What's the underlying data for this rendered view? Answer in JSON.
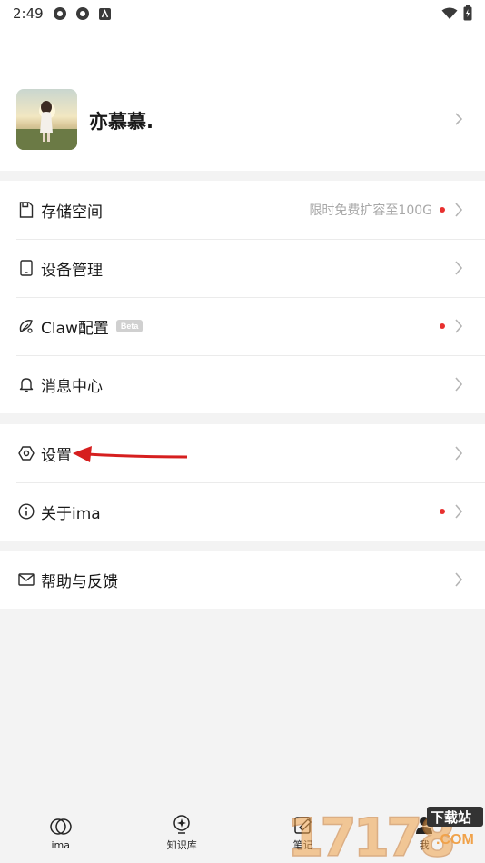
{
  "status_bar": {
    "time": "2:49"
  },
  "profile": {
    "username": "亦慕慕."
  },
  "menu_group_1": [
    {
      "label": "存储空间",
      "hint": "限时免费扩容至100G",
      "dot": true,
      "icon": "storage-icon"
    },
    {
      "label": "设备管理",
      "hint": "",
      "dot": false,
      "icon": "device-icon"
    },
    {
      "label": "Claw配置",
      "badge": "Beta",
      "dot": true,
      "icon": "claw-icon"
    },
    {
      "label": "消息中心",
      "dot": false,
      "icon": "bell-icon"
    }
  ],
  "menu_group_2": [
    {
      "label": "设置",
      "dot": false,
      "icon": "settings-icon"
    },
    {
      "label": "关于ima",
      "dot": true,
      "icon": "info-icon"
    }
  ],
  "menu_group_3": [
    {
      "label": "帮助与反馈",
      "dot": false,
      "icon": "mail-icon"
    }
  ],
  "tabs": [
    {
      "label": "ima",
      "icon": "ima-logo-icon"
    },
    {
      "label": "知识库",
      "icon": "knowledge-bulb-icon"
    },
    {
      "label": "笔记",
      "icon": "note-icon"
    },
    {
      "label": "我",
      "icon": "person-icon"
    }
  ],
  "watermark": {
    "number": "17178",
    "brand": "下载站",
    "domain": ".COM"
  },
  "colors": {
    "accent_dot": "#e8302f",
    "annotation_arrow": "#d61f1f"
  }
}
